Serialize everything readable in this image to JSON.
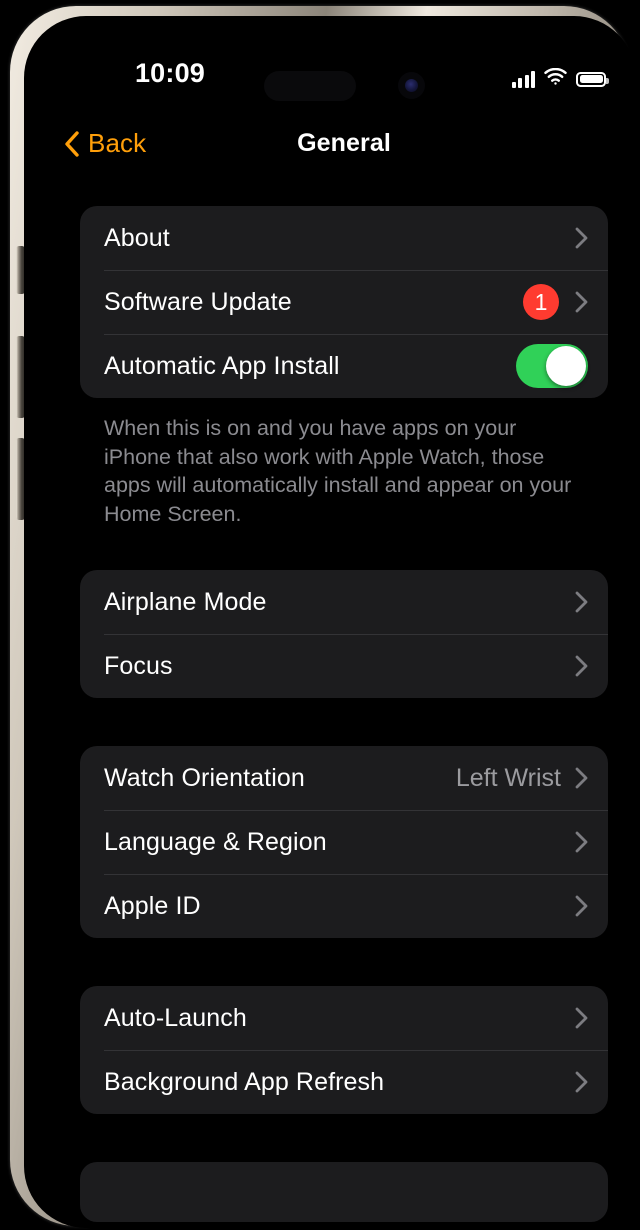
{
  "status_bar": {
    "time": "10:09",
    "signal_icon": "cellular-signal-icon",
    "wifi_icon": "wifi-icon",
    "battery_icon": "battery-full-icon"
  },
  "nav": {
    "back_label": "Back",
    "back_icon": "chevron-left-icon",
    "title": "General"
  },
  "colors": {
    "accent": "#FF9F0A",
    "badge": "#FF3B30",
    "toggle_on": "#30D158",
    "card": "#1C1C1E",
    "background": "#000000",
    "secondary_text": "#8B8B90"
  },
  "groups": [
    {
      "rows": [
        {
          "label": "About",
          "accessory": "chevron"
        },
        {
          "label": "Software Update",
          "accessory": "chevron",
          "badge": "1"
        },
        {
          "label": "Automatic App Install",
          "accessory": "toggle",
          "toggle_on": true
        }
      ],
      "footer": "When this is on and you have apps on your iPhone that also work with Apple Watch, those apps will automatically install and appear on your\nHome Screen."
    },
    {
      "rows": [
        {
          "label": "Airplane Mode",
          "accessory": "chevron"
        },
        {
          "label": "Focus",
          "accessory": "chevron"
        }
      ]
    },
    {
      "rows": [
        {
          "label": "Watch Orientation",
          "accessory": "chevron",
          "value": "Left Wrist"
        },
        {
          "label": "Language & Region",
          "accessory": "chevron"
        },
        {
          "label": "Apple ID",
          "accessory": "chevron"
        }
      ]
    },
    {
      "rows": [
        {
          "label": "Auto-Launch",
          "accessory": "chevron"
        },
        {
          "label": "Background App Refresh",
          "accessory": "chevron"
        }
      ]
    }
  ]
}
